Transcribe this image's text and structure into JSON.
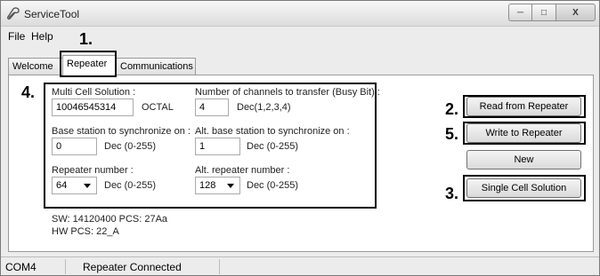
{
  "window": {
    "title": "ServiceTool"
  },
  "menu": {
    "file": "File",
    "help": "Help"
  },
  "tabs": {
    "welcome": "Welcome",
    "repeater": "Repeater",
    "communications": "Communications"
  },
  "annotations": {
    "n1": "1.",
    "n2": "2.",
    "n3": "3.",
    "n4": "4.",
    "n5": "5."
  },
  "form": {
    "multi_cell_label": "Multi Cell Solution :",
    "multi_cell_value": "10046545314",
    "multi_cell_unit": "OCTAL",
    "channels_label": "Number of channels to transfer (Busy Bit) :",
    "channels_value": "4",
    "channels_hint": "Dec(1,2,3,4)",
    "base_label": "Base station to synchronize on :",
    "base_value": "0",
    "base_hint": "Dec (0-255)",
    "alt_base_label": "Alt. base station to synchronize on :",
    "alt_base_value": "1",
    "alt_base_hint": "Dec (0-255)",
    "repeater_label": "Repeater number :",
    "repeater_value": "64",
    "repeater_hint": "Dec (0-255)",
    "alt_repeater_label": "Alt. repeater number :",
    "alt_repeater_value": "128",
    "alt_repeater_hint": "Dec (0-255)"
  },
  "info": {
    "sw": "SW: 14120400 PCS: 27Aa",
    "hw": "HW PCS: 22_A"
  },
  "buttons": {
    "read": "Read from Repeater",
    "write": "Write to Repeater",
    "new": "New",
    "single": "Single Cell Solution"
  },
  "status": {
    "port": "COM4",
    "state": "Repeater Connected"
  }
}
